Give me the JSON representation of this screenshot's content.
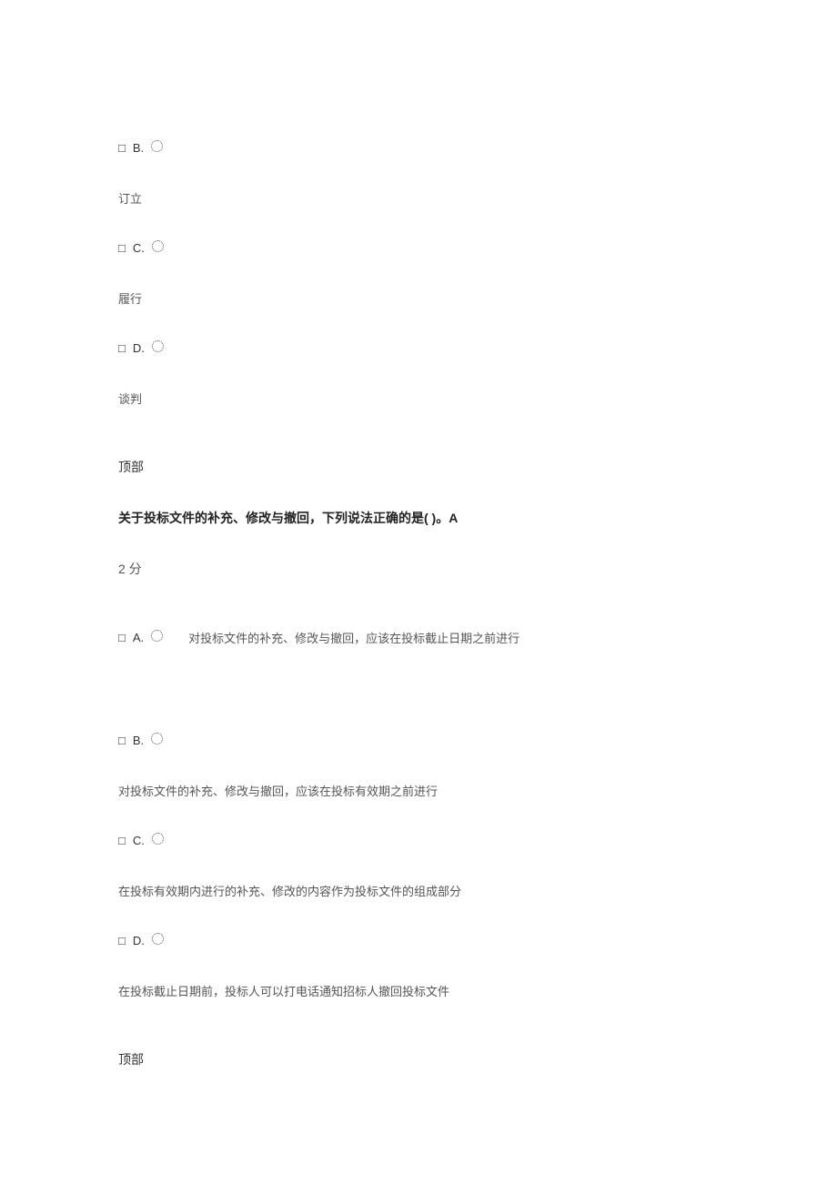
{
  "q1": {
    "options": {
      "b": {
        "box": "□",
        "letter": "B.",
        "text": "订立"
      },
      "c": {
        "box": "□",
        "letter": "C.",
        "text": "履行"
      },
      "d": {
        "box": "□",
        "letter": "D.",
        "text": "谈判"
      }
    },
    "top_link": "顶部"
  },
  "q2": {
    "title": "关于投标文件的补充、修改与撤回，下列说法正确的是( )。A",
    "points": "2 分",
    "options": {
      "a": {
        "box": "□",
        "letter": "A.",
        "text": "对投标文件的补充、修改与撤回，应该在投标截止日期之前进行"
      },
      "b": {
        "box": "□",
        "letter": "B.",
        "text": "对投标文件的补充、修改与撤回，应该在投标有效期之前进行"
      },
      "c": {
        "box": "□",
        "letter": "C.",
        "text": "在投标有效期内进行的补充、修改的内容作为投标文件的组成部分"
      },
      "d": {
        "box": "□",
        "letter": "D.",
        "text": "在投标截止日期前，投标人可以打电话通知招标人撤回投标文件"
      }
    },
    "top_link": "顶部"
  }
}
